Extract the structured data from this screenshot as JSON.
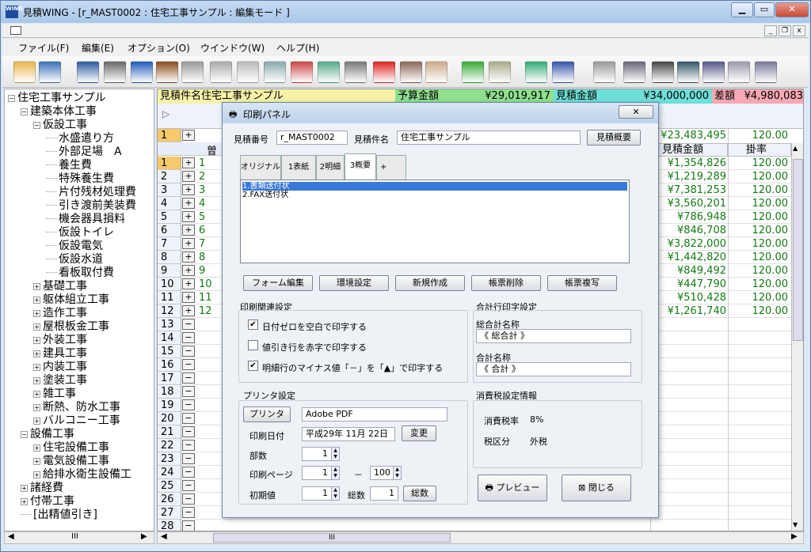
{
  "window": {
    "title": "見積WING - [r_MAST0002 : 住宅工事サンプル : 編集モード ]",
    "app_icon": "WING"
  },
  "menu": [
    "ファイル(F)",
    "編集(E)",
    "オプション(O)",
    "ウインドウ(W)",
    "ヘルプ(H)"
  ],
  "toolbar_icons": [
    "open-folder-icon",
    "monitor-icon",
    "save-icon",
    "print-icon",
    "close-x-icon",
    "door-icon",
    "scissors-icon",
    "copy-icon",
    "paste-icon",
    "insert-icon",
    "delete-row-icon",
    "insert-row-icon",
    "calculator-icon",
    "cut-red-icon",
    "person-icon",
    "edit-icon",
    "add-green-icon",
    "lock-icon",
    "tree-icon",
    "clip-icon",
    "gear-icon",
    "keyboard-icon",
    "printer2-icon",
    "export-icon",
    "decimal-icon",
    "layout-icon",
    "doc-icon"
  ],
  "tree": {
    "nodes": [
      {
        "label": "住宅工事サンプル",
        "level": 0,
        "box": "−"
      },
      {
        "label": "建築本体工事",
        "level": 1,
        "box": "−"
      },
      {
        "label": "仮設工事",
        "level": 2,
        "box": "−"
      },
      {
        "label": "水盛遣り方",
        "level": 3,
        "box": ""
      },
      {
        "label": "外部足場　A",
        "level": 3,
        "box": ""
      },
      {
        "label": "養生費",
        "level": 3,
        "box": ""
      },
      {
        "label": "特殊養生費",
        "level": 3,
        "box": ""
      },
      {
        "label": "片付残材処理費",
        "level": 3,
        "box": ""
      },
      {
        "label": "引き渡前美装費",
        "level": 3,
        "box": ""
      },
      {
        "label": "機会器具損料",
        "level": 3,
        "box": ""
      },
      {
        "label": "仮設トイレ",
        "level": 3,
        "box": ""
      },
      {
        "label": "仮設電気",
        "level": 3,
        "box": ""
      },
      {
        "label": "仮設水道",
        "level": 3,
        "box": ""
      },
      {
        "label": "看板取付費",
        "level": 3,
        "box": ""
      },
      {
        "label": "基礎工事",
        "level": 2,
        "box": "+"
      },
      {
        "label": "躯体組立工事",
        "level": 2,
        "box": "+"
      },
      {
        "label": "造作工事",
        "level": 2,
        "box": "+"
      },
      {
        "label": "屋根板金工事",
        "level": 2,
        "box": "+"
      },
      {
        "label": "外装工事",
        "level": 2,
        "box": "+"
      },
      {
        "label": "建具工事",
        "level": 2,
        "box": "+"
      },
      {
        "label": "内装工事",
        "level": 2,
        "box": "+"
      },
      {
        "label": "塗装工事",
        "level": 2,
        "box": "+"
      },
      {
        "label": "雑工事",
        "level": 2,
        "box": "+"
      },
      {
        "label": "断熱、防水工事",
        "level": 2,
        "box": "+"
      },
      {
        "label": "バルコニー工事",
        "level": 2,
        "box": "+"
      },
      {
        "label": "設備工事",
        "level": 1,
        "box": "−"
      },
      {
        "label": "住宅設備工事",
        "level": 2,
        "box": "+"
      },
      {
        "label": "電気設備工事",
        "level": 2,
        "box": "+"
      },
      {
        "label": "給排水衛生設備工",
        "level": 2,
        "box": "+"
      },
      {
        "label": "諸経費",
        "level": 1,
        "box": "+"
      },
      {
        "label": "付帯工事",
        "level": 1,
        "box": "+"
      },
      {
        "label": "[出精値引き]",
        "level": 1,
        "box": ""
      }
    ],
    "scroll_mark": "III"
  },
  "infobar": {
    "name_label": "見積件名",
    "name_value": "住宅工事サンプル",
    "budget_label": "予算金額",
    "budget_value": "¥29,019,917",
    "estimate_label": "見積金額",
    "estimate_value": "¥34,000,000",
    "diff_label": "差額",
    "diff_value": "¥4,980,083"
  },
  "grid": {
    "header_partial": "曽",
    "col_amount": "見積金額",
    "col_rate": "掛率",
    "top_row": {
      "num": "1",
      "amount": "¥23,483,495",
      "rate": "120.00"
    },
    "rows": [
      {
        "row": "1",
        "pm": "+",
        "num": "1",
        "amount": "¥1,354,826",
        "rate": "120.00"
      },
      {
        "row": "2",
        "pm": "+",
        "num": "2",
        "amount": "¥1,219,289",
        "rate": "120.00"
      },
      {
        "row": "3",
        "pm": "+",
        "num": "3",
        "amount": "¥7,381,253",
        "rate": "120.00"
      },
      {
        "row": "4",
        "pm": "+",
        "num": "4",
        "amount": "¥3,560,201",
        "rate": "120.00"
      },
      {
        "row": "5",
        "pm": "+",
        "num": "5",
        "amount": "¥786,948",
        "rate": "120.00"
      },
      {
        "row": "6",
        "pm": "+",
        "num": "6",
        "amount": "¥846,708",
        "rate": "120.00"
      },
      {
        "row": "7",
        "pm": "+",
        "num": "7",
        "amount": "¥3,822,000",
        "rate": "120.00"
      },
      {
        "row": "8",
        "pm": "+",
        "num": "8",
        "amount": "¥1,442,820",
        "rate": "120.00"
      },
      {
        "row": "9",
        "pm": "+",
        "num": "9",
        "amount": "¥849,492",
        "rate": "120.00"
      },
      {
        "row": "10",
        "pm": "+",
        "num": "10",
        "amount": "¥447,790",
        "rate": "120.00"
      },
      {
        "row": "11",
        "pm": "+",
        "num": "11",
        "amount": "¥510,428",
        "rate": "120.00"
      },
      {
        "row": "12",
        "pm": "+",
        "num": "12",
        "amount": "¥1,261,740",
        "rate": "120.00"
      },
      {
        "row": "13",
        "pm": "−",
        "num": "",
        "amount": "",
        "rate": ""
      },
      {
        "row": "14",
        "pm": "−",
        "num": "",
        "amount": "",
        "rate": ""
      },
      {
        "row": "15",
        "pm": "−",
        "num": "",
        "amount": "",
        "rate": ""
      },
      {
        "row": "16",
        "pm": "−",
        "num": "",
        "amount": "",
        "rate": ""
      },
      {
        "row": "17",
        "pm": "−",
        "num": "",
        "amount": "",
        "rate": ""
      },
      {
        "row": "18",
        "pm": "−",
        "num": "",
        "amount": "",
        "rate": ""
      },
      {
        "row": "19",
        "pm": "−",
        "num": "",
        "amount": "",
        "rate": ""
      },
      {
        "row": "20",
        "pm": "−",
        "num": "",
        "amount": "",
        "rate": ""
      },
      {
        "row": "21",
        "pm": "−",
        "num": "",
        "amount": "",
        "rate": ""
      },
      {
        "row": "22",
        "pm": "−",
        "num": "",
        "amount": "",
        "rate": ""
      },
      {
        "row": "23",
        "pm": "−",
        "num": "",
        "amount": "",
        "rate": ""
      },
      {
        "row": "24",
        "pm": "−",
        "num": "",
        "amount": "",
        "rate": ""
      },
      {
        "row": "25",
        "pm": "−",
        "num": "",
        "amount": "",
        "rate": ""
      },
      {
        "row": "26",
        "pm": "−",
        "num": "",
        "amount": "",
        "rate": ""
      },
      {
        "row": "27",
        "pm": "−",
        "num": "",
        "amount": "",
        "rate": ""
      },
      {
        "row": "28",
        "pm": "−",
        "num": "",
        "amount": "",
        "rate": ""
      }
    ],
    "scroll_mark": "III"
  },
  "dialog": {
    "title": "印刷パネル",
    "close_label": "✕",
    "est_no_label": "見積番号",
    "est_no_value": "r_MAST0002",
    "est_name_label": "見積件名",
    "est_name_value": "住宅工事サンプル",
    "overview_button": "見積概要",
    "tabs": [
      "オリジナル",
      "1表紙",
      "2明細",
      "3概要",
      "+"
    ],
    "active_tab": 3,
    "list_items": [
      "1.書類送付状",
      "2.FAX送付状"
    ],
    "action_buttons": [
      "フォーム編集",
      "環境設定",
      "新規作成",
      "帳票削除",
      "帳票複写"
    ],
    "print_settings": {
      "title": "印刷関連設定",
      "options": [
        {
          "label": "日付ゼロを空白で印字する",
          "checked": true
        },
        {
          "label": "値引き行を赤字で印字する",
          "checked": false
        },
        {
          "label": "明細行のマイナス値「－」を「▲」で印字する",
          "checked": true
        }
      ]
    },
    "total_print": {
      "title": "合計行印字設定",
      "grand_total_label": "総合計名称",
      "grand_total_value": "《 総合計 》",
      "total_label": "合計名称",
      "total_value": "《 合計 》"
    },
    "printer": {
      "title": "プリンタ設定",
      "printer_button": "プリンタ",
      "printer_name": "Adobe PDF",
      "date_label": "印刷日付",
      "date_value": "平成29年 11月 22日",
      "change_button": "変更",
      "copies_label": "部数",
      "copies_value": "1",
      "pages_label": "印刷ページ",
      "page_from": "1",
      "page_sep": "－",
      "page_to": "100",
      "initial_label": "初期値",
      "initial_value": "1",
      "total_pages_label": "総数",
      "total_pages_value": "1",
      "total_pages_button": "総数"
    },
    "tax": {
      "title": "消費税設定情報",
      "rate_label": "消費税率",
      "rate_value": "8%",
      "type_label": "税区分",
      "type_value": "外税"
    },
    "preview_button": "プレビュー",
    "close_button": "閉じる"
  },
  "colors": {
    "selected_row": "#f6c96a",
    "budget_bg": "#8fe08f",
    "estimate_bg": "#6fe0d8",
    "diff_bg": "#f7a8b4",
    "name_bg": "#f7f2a8",
    "amount_green": "#137a13"
  }
}
